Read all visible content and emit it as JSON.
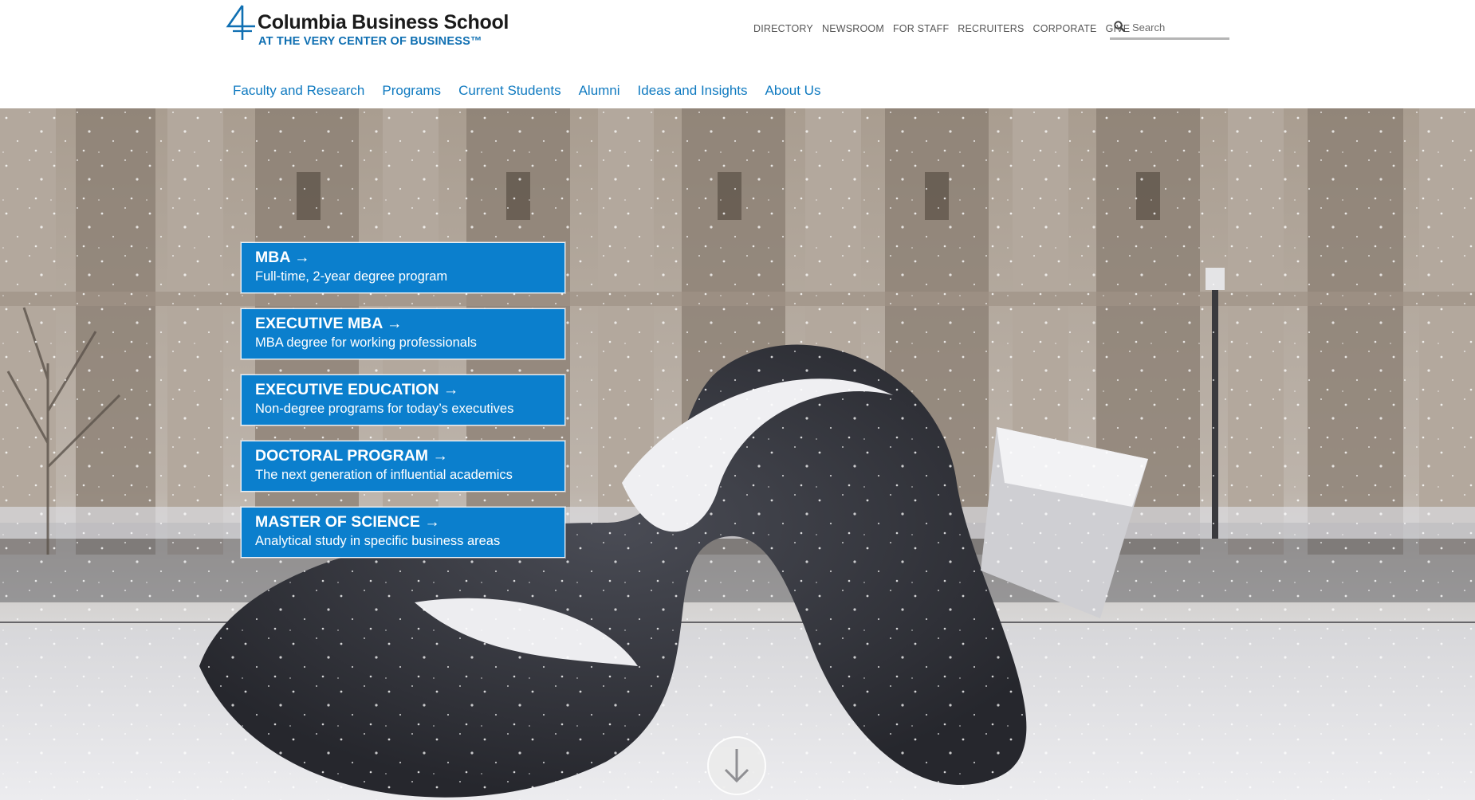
{
  "header": {
    "logo_name": "Columbia Business School",
    "logo_tagline": "AT THE VERY CENTER OF BUSINESS™",
    "utility_links": [
      "DIRECTORY",
      "NEWSROOM",
      "FOR STAFF",
      "RECRUITERS",
      "CORPORATE",
      "GIVE"
    ],
    "search": {
      "placeholder": "Search",
      "value": ""
    },
    "main_nav": [
      "Faculty and Research",
      "Programs",
      "Current Students",
      "Alumni",
      "Ideas and Insights",
      "About Us"
    ]
  },
  "hero": {
    "programs": [
      {
        "title": "MBA →",
        "desc": "Full-time, 2-year degree program"
      },
      {
        "title": "EXECUTIVE MBA →",
        "desc": "MBA degree for working professionals"
      },
      {
        "title": "EXECUTIVE EDUCATION →",
        "desc": "Non-degree programs for today’s executives"
      },
      {
        "title": "DOCTORAL PROGRAM →",
        "desc": "The next generation of influential academics"
      },
      {
        "title": "MASTER OF SCIENCE →",
        "desc": "Analytical study in specific business areas"
      }
    ]
  },
  "colors": {
    "brand_blue": "#0f7ac0",
    "card_blue": "#0b7fcd",
    "tagline_blue": "#0f6fb2"
  },
  "icons": {
    "logo": "columbia-crown-cross-icon",
    "search": "magnifier-icon",
    "scroll": "arrow-down-circle-icon"
  }
}
